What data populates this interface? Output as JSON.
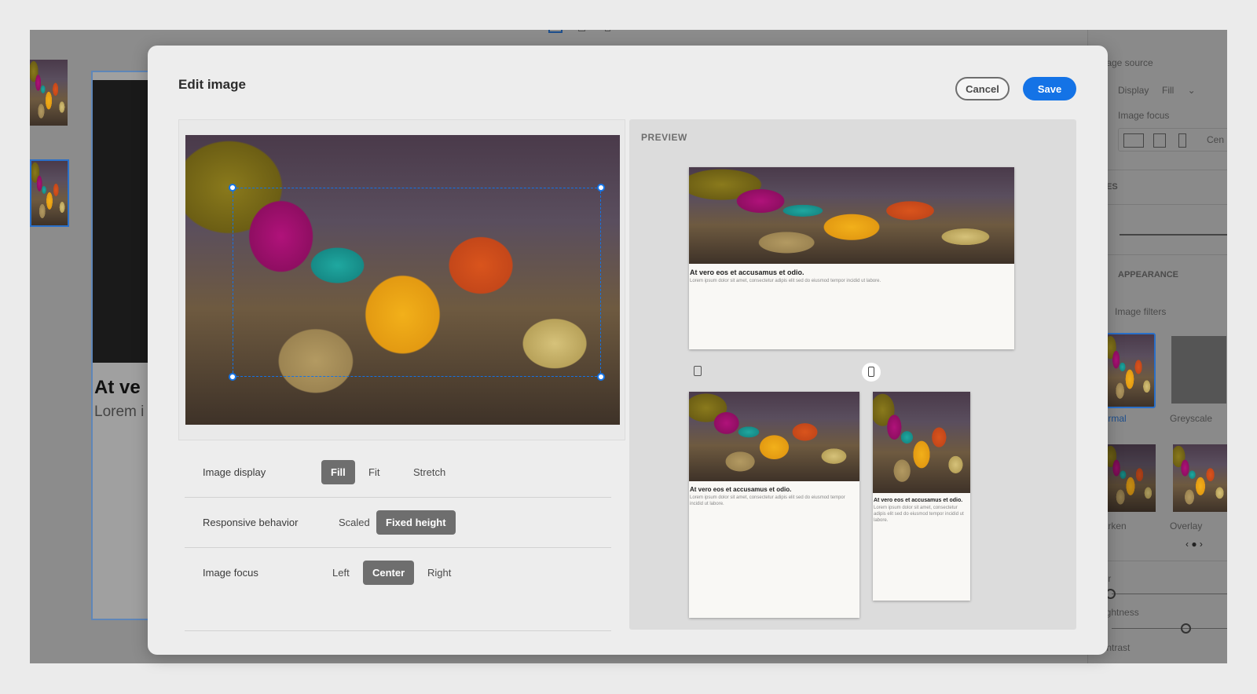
{
  "background_app": {
    "canvas_heading": "At ve",
    "canvas_body": "Lorem i",
    "right_panel": {
      "image_source": "Image source",
      "display_label": "Display",
      "display_value": "Fill",
      "image_focus_label": "Image focus",
      "image_focus_value": "Cen",
      "states_header": "STATES",
      "appearance_header": "APPEARANCE",
      "image_filters_label": "Image filters",
      "filters": [
        "Normal",
        "Greyscale",
        "Darken",
        "Overlay"
      ],
      "sliders": [
        "Blur",
        "Brightness",
        "Contrast"
      ]
    }
  },
  "modal": {
    "title": "Edit image",
    "cancel_label": "Cancel",
    "save_label": "Save",
    "options": [
      {
        "label": "Image display",
        "choices": [
          "Fill",
          "Fit",
          "Stretch"
        ],
        "selected": "Fill"
      },
      {
        "label": "Responsive behavior",
        "choices": [
          "Scaled",
          "Fixed height"
        ],
        "selected": "Fixed height"
      },
      {
        "label": "Image focus",
        "choices": [
          "Left",
          "Center",
          "Right"
        ],
        "selected": "Center"
      }
    ],
    "preview": {
      "label": "PREVIEW",
      "card_title": "At vero eos et accusamus et odio.",
      "card_body": "Lorem ipsum dolor sit amet, consectetur adipis elit sed do eiusmod tempor incidid ut labore.",
      "devices": [
        "desktop",
        "tablet",
        "mobile"
      ],
      "active_device": "mobile"
    }
  },
  "colors": {
    "accent": "#1473e6",
    "selected_option": "#6e6e6e"
  }
}
